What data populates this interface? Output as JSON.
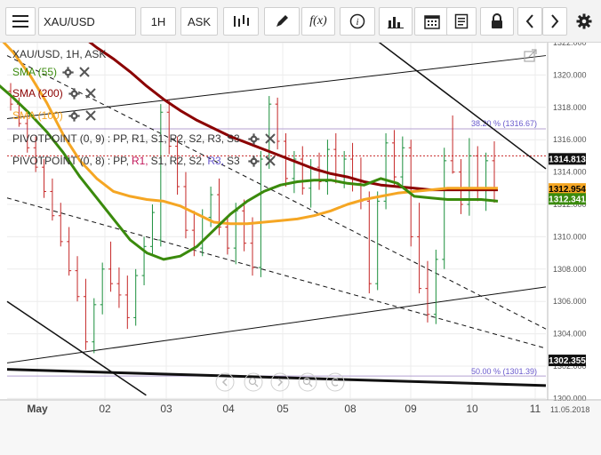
{
  "toolbar": {
    "symbol": "XAU/USD",
    "timeframe": "1H",
    "price_type": "ASK",
    "icons": [
      "menu-icon",
      "candles-icon",
      "pencil-icon",
      "fx-icon",
      "info-icon",
      "bars-icon",
      "calendar-icon",
      "document-icon",
      "lock-icon",
      "chevron-left-icon",
      "chevron-right-icon",
      "gear-icon"
    ]
  },
  "legend": {
    "title": "XAU/USD, 1H, ASK",
    "sma55": "SMA (55)",
    "sma200": "SMA (200)",
    "sma100": "SMA (100)",
    "pivot1_prefix": "PIVOTPOINT (0, 9)",
    "pivot2_prefix": "PIVOTPOINT (0, 8)",
    "pivot_items": [
      ":",
      "PP,",
      "R1,",
      "S1,",
      "R2,",
      "S2,",
      "R3,",
      "S3"
    ]
  },
  "colors": {
    "sma55": "#3a8a0c",
    "sma200": "#8b0000",
    "sma100": "#f5a623",
    "up_bar": "#1a8f3c",
    "down_bar": "#c62828",
    "pivot_line": "#b4a0d2",
    "fib_label": "#6a5acd",
    "price_badge": "#111111"
  },
  "chart_data": {
    "type": "line",
    "instrument": "XAU/USD",
    "ylim": [
      1300.0,
      1322.0
    ],
    "y_ticks": [
      "1322.000",
      "1320.000",
      "1318.000",
      "1316.000",
      "1314.000",
      "1312.000",
      "1310.000",
      "1308.000",
      "1306.000",
      "1304.000",
      "1302.000",
      "1300.000"
    ],
    "x_ticks": [
      "May",
      "02",
      "03",
      "04",
      "05",
      "08",
      "09",
      "10",
      "11"
    ],
    "x_end_date": "11.05.2018",
    "series": [
      {
        "name": "SMA (55)",
        "values": [
          1319.5,
          1318.6,
          1317.6,
          1316.5,
          1315.2,
          1313.7,
          1312.4,
          1311.1,
          1309.8,
          1309.0,
          1308.6,
          1308.8,
          1309.4,
          1310.4,
          1311.4,
          1312.2,
          1312.8,
          1313.2,
          1313.4,
          1313.5,
          1313.5,
          1313.3,
          1313.2,
          1313.6,
          1313.3,
          1312.5,
          1312.4,
          1312.3,
          1312.3,
          1312.3,
          1312.2
        ]
      },
      {
        "name": "SMA (200)",
        "values": [
          1326.0,
          1325.3,
          1324.6,
          1323.9,
          1323.2,
          1322.5,
          1321.7,
          1321.0,
          1320.2,
          1319.3,
          1318.5,
          1317.8,
          1317.2,
          1316.7,
          1316.2,
          1315.8,
          1315.4,
          1315.0,
          1314.6,
          1314.2,
          1313.9,
          1313.7,
          1313.4,
          1313.2,
          1313.1,
          1313.0,
          1312.9,
          1312.9,
          1312.9,
          1312.9,
          1312.9
        ]
      },
      {
        "name": "SMA (100)",
        "values": [
          1322.5,
          1321.4,
          1320.0,
          1318.3,
          1316.3,
          1314.7,
          1313.6,
          1312.8,
          1312.5,
          1312.3,
          1312.2,
          1311.9,
          1311.4,
          1310.9,
          1310.8,
          1310.8,
          1310.9,
          1311.0,
          1311.1,
          1311.3,
          1311.6,
          1312.0,
          1312.3,
          1312.5,
          1312.7,
          1312.8,
          1312.9,
          1313.0,
          1313.0,
          1313.0,
          1313.0
        ]
      }
    ],
    "ohlc_bars": [
      [
        1319.0,
        1319.5,
        1317.8,
        1318.2
      ],
      [
        1318.2,
        1318.6,
        1316.8,
        1317.0
      ],
      [
        1317.0,
        1317.6,
        1315.2,
        1315.5
      ],
      [
        1315.5,
        1316.2,
        1314.0,
        1314.3
      ],
      [
        1314.3,
        1314.8,
        1312.4,
        1312.8
      ],
      [
        1312.8,
        1313.6,
        1311.0,
        1311.3
      ],
      [
        1311.3,
        1312.1,
        1309.4,
        1309.7
      ],
      [
        1309.7,
        1310.6,
        1307.6,
        1307.9
      ],
      [
        1307.9,
        1308.8,
        1306.0,
        1306.3
      ],
      [
        1306.3,
        1307.4,
        1303.0,
        1303.5
      ],
      [
        1303.5,
        1306.2,
        1302.8,
        1305.8
      ],
      [
        1305.8,
        1308.4,
        1305.2,
        1308.0
      ],
      [
        1308.0,
        1309.7,
        1306.6,
        1307.1
      ],
      [
        1307.1,
        1308.1,
        1305.6,
        1306.4
      ],
      [
        1306.4,
        1307.6,
        1304.3,
        1305.0
      ],
      [
        1305.0,
        1308.0,
        1304.5,
        1307.6
      ],
      [
        1307.6,
        1310.0,
        1307.0,
        1309.4
      ],
      [
        1309.4,
        1312.0,
        1308.8,
        1311.5
      ],
      [
        1309.8,
        1318.2,
        1309.4,
        1317.7
      ],
      [
        1317.7,
        1318.5,
        1315.1,
        1315.6
      ],
      [
        1315.6,
        1316.2,
        1312.6,
        1313.1
      ],
      [
        1313.1,
        1314.0,
        1309.9,
        1310.4
      ],
      [
        1310.4,
        1311.6,
        1308.8,
        1309.3
      ],
      [
        1309.3,
        1311.7,
        1308.8,
        1311.2
      ],
      [
        1311.2,
        1313.1,
        1310.6,
        1312.6
      ],
      [
        1312.6,
        1313.6,
        1310.1,
        1310.6
      ],
      [
        1310.6,
        1311.2,
        1308.9,
        1309.3
      ],
      [
        1309.3,
        1312.1,
        1308.3,
        1311.6
      ],
      [
        1311.6,
        1312.3,
        1309.1,
        1309.6
      ],
      [
        1309.6,
        1311.2,
        1307.6,
        1308.1
      ],
      [
        1308.1,
        1315.3,
        1307.5,
        1314.8
      ],
      [
        1314.8,
        1318.7,
        1314.2,
        1318.2
      ],
      [
        1318.2,
        1318.6,
        1315.4,
        1315.9
      ],
      [
        1315.9,
        1316.4,
        1313.1,
        1313.6
      ],
      [
        1313.6,
        1315.3,
        1312.7,
        1314.8
      ],
      [
        1314.8,
        1315.6,
        1312.6,
        1313.0
      ],
      [
        1313.0,
        1314.8,
        1311.8,
        1314.3
      ],
      [
        1314.3,
        1315.2,
        1312.9,
        1313.4
      ],
      [
        1313.4,
        1316.0,
        1312.6,
        1315.4
      ],
      [
        1315.4,
        1316.4,
        1313.3,
        1313.8
      ],
      [
        1313.8,
        1315.3,
        1313.0,
        1314.8
      ],
      [
        1314.8,
        1315.8,
        1312.8,
        1313.3
      ],
      [
        1313.3,
        1314.9,
        1311.7,
        1312.2
      ],
      [
        1312.2,
        1312.8,
        1306.5,
        1307.1
      ],
      [
        1307.1,
        1312.8,
        1306.7,
        1312.2
      ],
      [
        1312.2,
        1316.4,
        1311.7,
        1315.8
      ],
      [
        1315.8,
        1316.6,
        1313.2,
        1313.7
      ],
      [
        1313.7,
        1316.2,
        1313.1,
        1315.5
      ],
      [
        1315.5,
        1316.0,
        1309.4,
        1310.0
      ],
      [
        1310.0,
        1312.1,
        1306.5,
        1306.8
      ],
      [
        1306.8,
        1308.5,
        1304.7,
        1305.2
      ],
      [
        1305.2,
        1309.2,
        1304.6,
        1308.6
      ],
      [
        1308.6,
        1315.5,
        1308.0,
        1314.7
      ],
      [
        1314.7,
        1317.5,
        1313.9,
        1314.0
      ],
      [
        1314.0,
        1314.8,
        1311.4,
        1312.0
      ],
      [
        1312.0,
        1316.1,
        1311.3,
        1315.0
      ],
      [
        1315.0,
        1315.6,
        1312.2,
        1313.0
      ],
      [
        1313.0,
        1315.2,
        1311.6,
        1314.7
      ],
      [
        1314.7,
        1315.9,
        1312.1,
        1312.9
      ]
    ],
    "trendlines": [
      {
        "x": [
          0,
          31
        ],
        "y": [
          1317.3,
          1321.2
        ]
      },
      {
        "x": [
          0,
          31
        ],
        "y": [
          1302.2,
          1306.9
        ]
      },
      {
        "x": [
          0,
          31
        ],
        "y": [
          1321.2,
          1304.3
        ]
      },
      {
        "x": [
          0,
          31
        ],
        "y": [
          1312.4,
          1303.1
        ]
      },
      {
        "x": [
          0,
          31
        ],
        "y": [
          1301.8,
          1300.8
        ]
      },
      {
        "x": [
          18,
          31
        ],
        "y": [
          1324.8,
          1314.2
        ]
      },
      {
        "x": [
          0,
          8
        ],
        "y": [
          1306.0,
          1300.2
        ]
      }
    ],
    "pivot_levels": [
      1316.67,
      1301.39,
      1315.0
    ],
    "fib_labels": [
      "38.20 % (1316.67)",
      "50.00 % (1301.39)"
    ],
    "last_prices": [
      {
        "label": "1314.813",
        "value": 1314.813,
        "bg": "#111111",
        "fg": "#ffffff"
      },
      {
        "label": "1312.954",
        "value": 1312.954,
        "bg": "#f5a623",
        "fg": "#000000"
      },
      {
        "label": "1312.341",
        "value": 1312.341,
        "bg": "#3a8a0c",
        "fg": "#ffffff"
      },
      {
        "label": "1302.355",
        "value": 1302.355,
        "bg": "#111111",
        "fg": "#ffffff"
      }
    ]
  }
}
